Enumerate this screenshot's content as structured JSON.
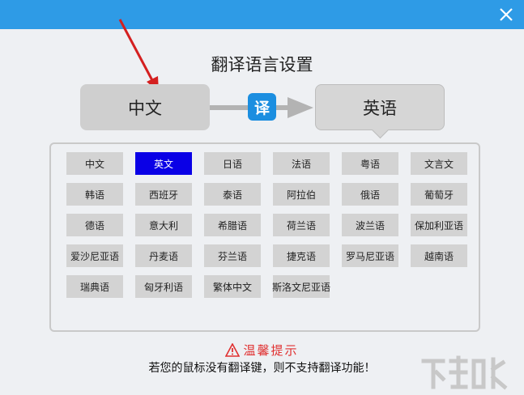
{
  "window": {
    "close_icon": "close-icon",
    "titlebar_color": "#2e9be6"
  },
  "heading": "翻译语言设置",
  "source_language": "中文",
  "target_language": "英语",
  "translate_badge": "译",
  "languages": [
    "中文",
    "英文",
    "日语",
    "法语",
    "粤语",
    "文言文",
    "韩语",
    "西班牙",
    "泰语",
    "阿拉伯",
    "俄语",
    "葡萄牙",
    "德语",
    "意大利",
    "希腊语",
    "荷兰语",
    "波兰语",
    "保加利亚语",
    "爱沙尼亚语",
    "丹麦语",
    "芬兰语",
    "捷克语",
    "罗马尼亚语",
    "越南语",
    "瑞典语",
    "匈牙利语",
    "繁体中文",
    "斯洛文尼亚语"
  ],
  "selected_language": "英文",
  "colors": {
    "selected": "#0a00e6",
    "button": "#d3d3d3",
    "tip": "#e03030"
  },
  "tip": {
    "icon": "warning-icon",
    "title": "温馨提示",
    "message": "若您的鼠标没有翻译键，则不支持翻译功能！"
  }
}
